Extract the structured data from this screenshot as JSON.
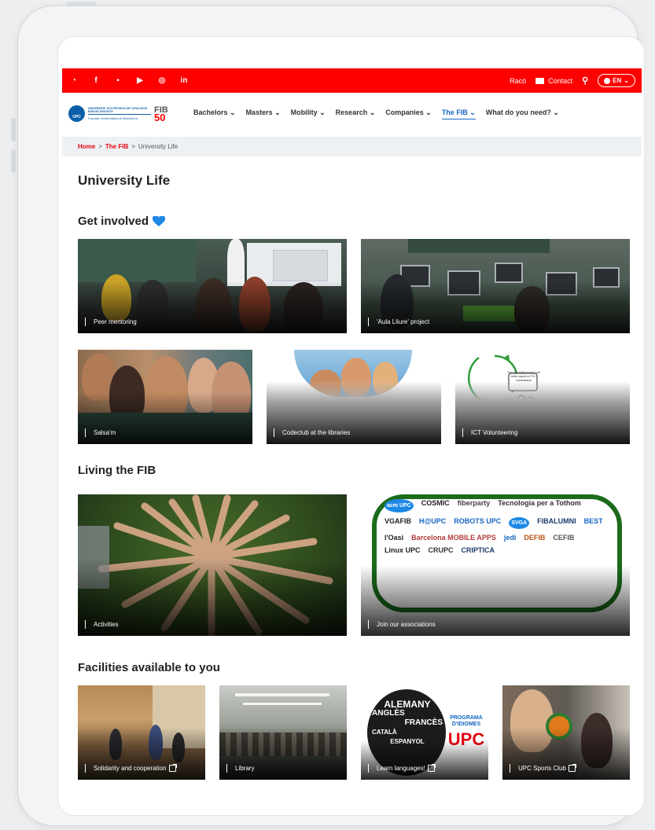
{
  "topbar": {
    "social": [
      {
        "icon": "rss-icon",
        "glyph": "◔"
      },
      {
        "icon": "facebook-icon",
        "glyph": "f"
      },
      {
        "icon": "flickr-icon",
        "glyph": "▪"
      },
      {
        "icon": "youtube-icon",
        "glyph": "▶"
      },
      {
        "icon": "instagram-icon",
        "glyph": "◎"
      },
      {
        "icon": "linkedin-icon",
        "glyph": "in"
      }
    ],
    "raco": "Racó",
    "contact": "Contact",
    "lang": "EN"
  },
  "logo": {
    "upc_line1": "UNIVERSITAT POLITÈCNICA DE CATALUNYA BARCELONATECH",
    "upc_line2": "Facultat d'Informàtica de Barcelona",
    "upc_circle": "UPC",
    "fib": "FIB",
    "fifty": "50"
  },
  "menu": [
    {
      "label": "Bachelors ⌄",
      "active": false
    },
    {
      "label": "Masters ⌄",
      "active": false
    },
    {
      "label": "Mobility ⌄",
      "active": false
    },
    {
      "label": "Research ⌄",
      "active": false
    },
    {
      "label": "Companies ⌄",
      "active": false
    },
    {
      "label": "The FIB ⌄",
      "active": true
    },
    {
      "label": "What do you need? ⌄",
      "active": false
    }
  ],
  "breadcrumb": {
    "home": "Home",
    "sep": ">",
    "fib": "The FIB",
    "current": "University Life"
  },
  "page_title": "University Life",
  "sections": {
    "get_involved": "Get involved",
    "living": "Living the FIB",
    "facilities": "Facilities available to you"
  },
  "cards": {
    "peer": "Peer mentoring",
    "aula": "'Aula Lliure' project",
    "salsa": "Salsa'm",
    "codeclub": "Codeclub at the libraries",
    "ict": "ICT Volunteering",
    "activities": "Activities",
    "associations": "Join our associations",
    "solidarity": "Solidarity and cooperation",
    "library": "Library",
    "languages": "Learn languages!",
    "sports": "UPC Sports Club"
  },
  "ict_bubble": "Sóc una entitat social i vull rebre suport en TIC i comunicació",
  "associations_logos": [
    "acm UPC",
    "COSMIC",
    "fiberparty",
    "Tecnologia per a Tothom",
    "VGAFIB",
    "H@UPC",
    "ROBOTS UPC",
    "SVGA",
    "FIBALUMNI",
    "BEST",
    "l'Oasi",
    "Barcelona MOBILE APPS",
    "jedi",
    "DEFIB",
    "CEFIB",
    "Linux UPC",
    "CRUPC",
    "CRIPTICA"
  ],
  "languages_poster": {
    "words": [
      "ALEMANY",
      "ANGLÈS",
      "FRANCÈS",
      "CATALÀ",
      "ESPANYOL"
    ],
    "programa": "PROGRAMA D'IDIOMES",
    "upc": "UPC"
  },
  "colors": {
    "brand_red": "#ff0000",
    "link_blue": "#1565c0",
    "heart": "#1e88e5"
  }
}
